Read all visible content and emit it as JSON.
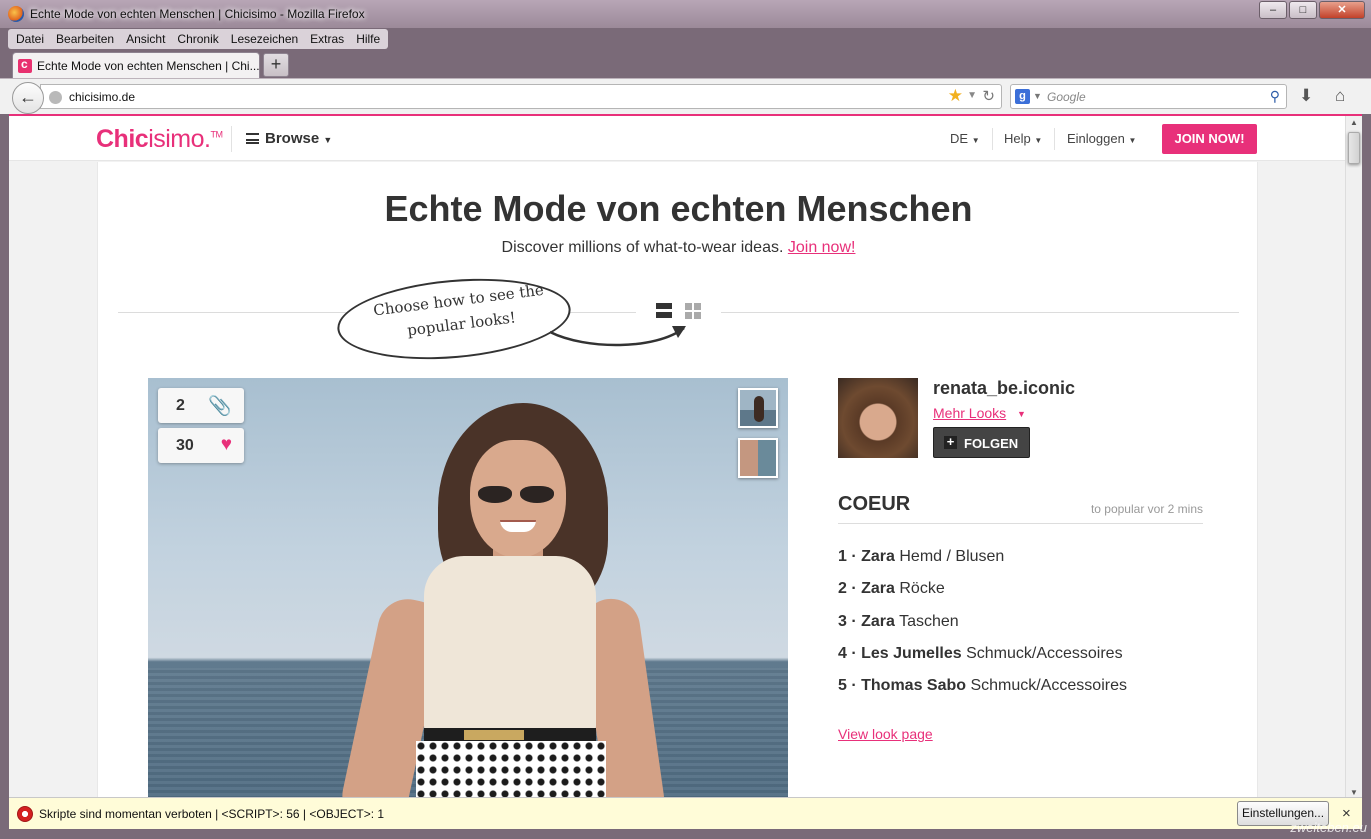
{
  "window": {
    "title": "Echte Mode von echten Menschen | Chicisimo - Mozilla Firefox",
    "controls": [
      "minimize",
      "maximize",
      "close"
    ]
  },
  "menu": [
    "Datei",
    "Bearbeiten",
    "Ansicht",
    "Chronik",
    "Lesezeichen",
    "Extras",
    "Hilfe"
  ],
  "tab": {
    "label": "Echte Mode von echten Menschen | Chi...",
    "new_tab": "+"
  },
  "navbar": {
    "url": "chicisimo.de",
    "search_placeholder": "Google",
    "search_engine_letter": "g"
  },
  "site": {
    "logo_part1": "Chic",
    "logo_part2": "isimo.",
    "logo_tm": "TM",
    "browse": "Browse",
    "lang": "DE",
    "help": "Help",
    "login": "Einloggen",
    "join": "JOIN NOW!",
    "headline": "Echte Mode von echten Menschen",
    "subline_text": "Discover millions of what-to-wear ideas.",
    "subline_link": "Join now!",
    "bubble_text": "Choose how to see the popular looks!"
  },
  "look": {
    "clips_count": "2",
    "likes_count": "30",
    "user": {
      "name": "renata_be.iconic",
      "more_looks": "Mehr Looks",
      "follow": "FOLGEN"
    },
    "section_title": "COEUR",
    "section_meta": "to popular vor 2 mins",
    "items": [
      {
        "num": "1",
        "brand": "Zara",
        "category": "Hemd / Blusen"
      },
      {
        "num": "2",
        "brand": "Zara",
        "category": "Röcke"
      },
      {
        "num": "3",
        "brand": "Zara",
        "category": "Taschen"
      },
      {
        "num": "4",
        "brand": "Les Jumelles",
        "category": "Schmuck/Accessoires"
      },
      {
        "num": "5",
        "brand": "Thomas Sabo",
        "category": "Schmuck/Accessoires"
      }
    ],
    "view_link": "View look page"
  },
  "notification": {
    "message": "Skripte sind momentan verboten | <SCRIPT>: 56 | <OBJECT>: 1",
    "settings_button": "Einstellungen...",
    "close": "×"
  },
  "watermark": "zweiteben.eu",
  "colors": {
    "brand": "#e8307a",
    "dark_button": "#444444",
    "notify_bg": "#fffcd8"
  },
  "icons": [
    "firefox-icon",
    "back-arrow-icon",
    "globe-icon",
    "bookmark-star-icon",
    "reload-icon",
    "search-magnifier-icon",
    "download-icon",
    "home-icon",
    "hamburger-icon",
    "list-view-icon",
    "grid-view-icon",
    "paperclip-icon",
    "heart-icon",
    "plus-icon",
    "noscript-icon"
  ]
}
